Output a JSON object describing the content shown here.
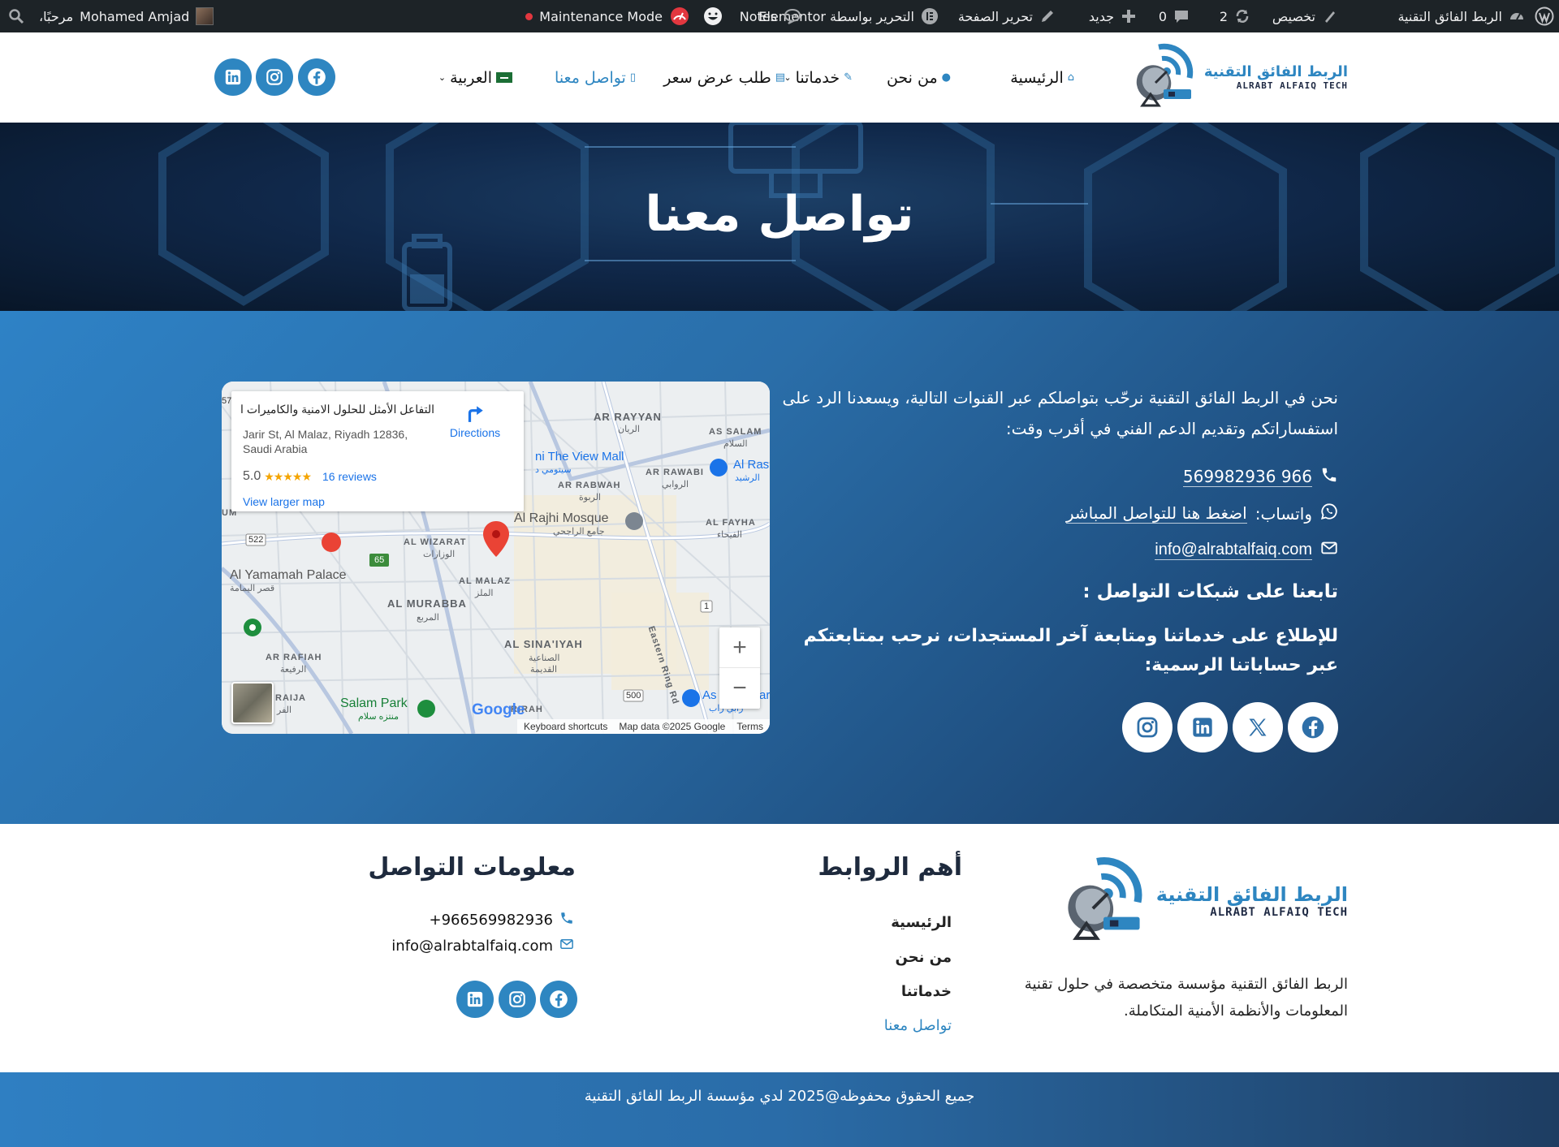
{
  "adminbar": {
    "site_name": "الربط الفائق التقنية",
    "customize": "تخصيص",
    "updates_count": "2",
    "comments_count": "0",
    "new": "جديد",
    "edit_page": "تحرير الصفحة",
    "edit_elementor": "التحرير بواسطة Elementor",
    "notes": "Notes",
    "maintenance": "Maintenance Mode",
    "greeting": "مرحبًا،",
    "user": "Mohamed Amjad"
  },
  "header": {
    "logo_ar": "الربط الفائق التقنية",
    "logo_en": "ALRABT ALFAIQ TECH",
    "nav": {
      "home": "الرئيسية",
      "about": "من نحن",
      "services": "خدماتنا",
      "quote": "طلب عرض سعر",
      "contact": "تواصل معنا",
      "lang": "العربية"
    }
  },
  "hero": {
    "title": "تواصل معنا"
  },
  "contact": {
    "intro": "نحن في الربط الفائق التقنية نرحّب بتواصلكم عبر القنوات التالية، ويسعدنا الرد على استفساراتكم وتقديم الدعم الفني في أقرب وقت:",
    "phone": "966 569982936",
    "whatsapp_prefix": "واتساب:",
    "whatsapp_link": "اضغط هنا للتواصل المباشر",
    "email": "info@alrabtalfaiq.com",
    "follow_title": "تابعنا على شبكات التواصل :",
    "follow_desc": "للإطلاع على خدماتنا ومتابعة آخر المستجدات، نرحب بمتابعتكم عبر حساباتنا الرسمية:"
  },
  "map": {
    "place": "التفاعل الأمثل للحلول الامنية والكاميرات الـ...",
    "address": "Jarir St, Al Malaz, Riyadh 12836, Saudi Arabia",
    "rating": "5.0",
    "stars": "★★★★★",
    "reviews": "16 reviews",
    "directions": "Directions",
    "larger": "View larger map",
    "zoom_in": "+",
    "zoom_out": "−",
    "google": "Google",
    "shortcuts": "Keyboard shortcuts",
    "mapdata": "Map data ©2025 Google",
    "terms": "Terms",
    "labels": {
      "ar_rayyan": "AR RAYYAN",
      "ar_rayyan_ar": "الريان",
      "as_salam": "AS SALAM",
      "as_salam_ar": "السلام",
      "view_mall": "ni The View Mall",
      "view_mall_ar": "سيتومي د",
      "ar_rabwah": "AR RABWAH",
      "ar_rabwah_ar": "الربوة",
      "ar_rawabi": "AR RAWABI",
      "ar_rawabi_ar": "الروابي",
      "al_rashid": "Al Ras",
      "al_rashid_ar": "الرشيد",
      "al_fayha": "AL FAYHA",
      "al_fayha_ar": "الفيحاء",
      "rajhi": "Al Rajhi Mosque",
      "rajhi_ar": "جامع الراجحي",
      "wizarat": "AL WIZARAT",
      "wizarat_ar": "الوزارات",
      "yamamah": "Al Yamamah Palace",
      "yamamah_ar": "قصر اليمامة",
      "malaz": "AL MALAZ",
      "malaz_ar": "الملز",
      "murabba": "AL MURABBA",
      "murabba_ar": "المربع",
      "sinaiyah": "AL SINA'IYAH",
      "sinaiyah_ar": "الصناعية",
      "sinaiyah_ar2": "القديمة",
      "rafiah": "AR RAFIAH",
      "rafiah_ar": "الرفيعة",
      "raija": "RAIJA",
      "raija_ar": "الفر",
      "salam_park": "Salam Park",
      "salam_park_ar": "منتزه سلام",
      "eastern_ring": "Eastern Ring Rd",
      "as_ar": "As",
      "as_ar2": "ar",
      "as_ar3": "رابي زاب",
      "rirah": "RIRAH",
      "r522": "522",
      "r65": "65",
      "r500": "500",
      "r1": "1",
      "r57": "57",
      "um": "UM"
    }
  },
  "footer": {
    "logo_ar": "الربط الفائق التقنية",
    "logo_en": "ALRABT ALFAIQ TECH",
    "desc": "الربط الفائق التقنية مؤسسة متخصصة في حلول تقنية المعلومات والأنظمة الأمنية المتكاملة.",
    "links_title": "أهم الروابط",
    "links": [
      "الرئيسية",
      "من نحن",
      "خدماتنا",
      "تواصل معنا"
    ],
    "info_title": "معلومات التواصل",
    "phone": "+966569982936",
    "email": "info@alrabtalfaiq.com",
    "copyright": "جميع الحقوق محفوظه@2025 لدي مؤسسة الربط الفائق التقنية"
  },
  "colors": {
    "brand_blue": "#2e86c1",
    "admin_bar": "#1d2327",
    "footer_title": "#1e2a3d"
  }
}
